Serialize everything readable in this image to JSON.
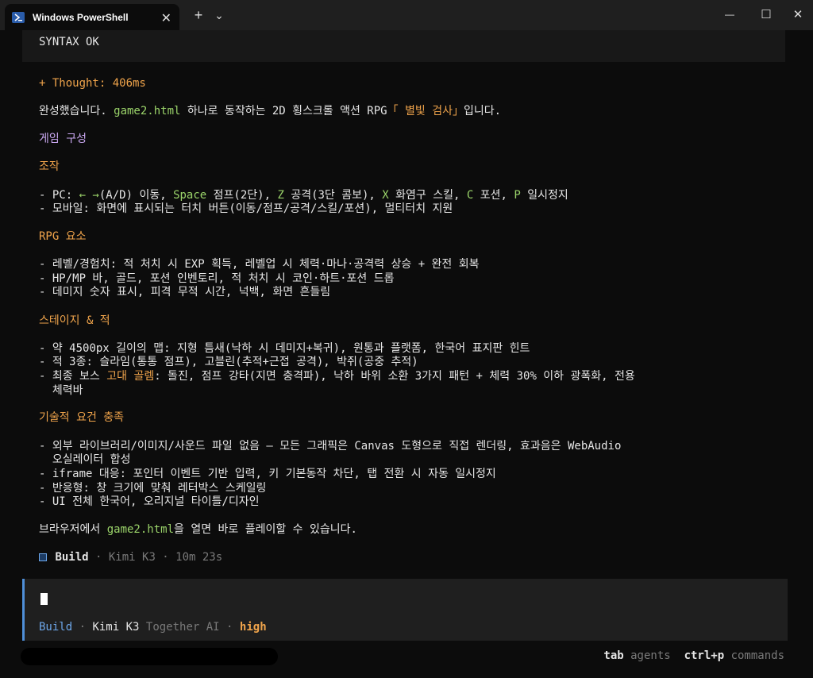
{
  "window": {
    "tab_title": "Windows PowerShell",
    "close_tab": "✕",
    "new_tab": "+",
    "dropdown": "⌄",
    "minimize": "—",
    "maximize": "☐",
    "close": "✕"
  },
  "output": {
    "syntax": "SYNTAX OK",
    "thought": "+ Thought: 406ms",
    "intro": {
      "a": "완성했습니다. ",
      "file": "game2.html",
      "b": " 하나로 동작하는 2D 횡스크롤 액션 RPG",
      "title": "「 별빛 검사」",
      "c": "입니다."
    },
    "h_game": "게임 구성",
    "h_controls": "조작",
    "pc": {
      "a": "- PC: ",
      "arrows": "← →",
      "b": "(A/D) 이동, ",
      "space": "Space",
      "c": " 점프(2단), ",
      "z": "Z",
      "d": " 공격(3단 콤보), ",
      "x": "X",
      "e": " 화염구 스킬, ",
      "cc": "C",
      "f": " 포션, ",
      "p": "P",
      "g": " 일시정지"
    },
    "mobile": "- 모바일: 화면에 표시되는 터치 버튼(이동/점프/공격/스킬/포션), 멀티터치 지원",
    "h_rpg": "RPG 요소",
    "rpg1": "- 레벨/경험치: 적 처치 시 EXP 획득, 레벨업 시 체력·마나·공격력 상승 + 완전 회복",
    "rpg2": "- HP/MP 바, 골드, 포션 인벤토리, 적 처치 시 코인·하트·포션 드롭",
    "rpg3": "- 데미지 숫자 표시, 피격 무적 시간, 넉백, 화면 흔들림",
    "h_stage": "스테이지 & 적",
    "st1": "- 약 4500px 길이의 맵: 지형 틈새(낙하 시 데미지+복귀), 원통과 플랫폼, 한국어 표지판 힌트",
    "st2": "- 적 3종: 슬라임(통통 점프), 고블린(추적+근접 공격), 박쥐(공중 추적)",
    "st3": {
      "a": "- 최종 보스 ",
      "boss": "고대 골렘",
      "b": ": 돌진, 점프 강타(지면 충격파), 낙하 바위 소환 3가지 패턴 + 체력 30% 이하 광폭화, 전용"
    },
    "st3b": "  체력바",
    "h_tech": "기술적 요건 충족",
    "t1": "- 외부 라이브러리/이미지/사운드 파일 없음 — 모든 그래픽은 Canvas 도형으로 직접 렌더링, 효과음은 WebAudio",
    "t1b": "  오실레이터 합성",
    "t2": "- iframe 대응: 포인터 이벤트 기반 입력, 키 기본동작 차단, 탭 전환 시 자동 일시정지",
    "t3": "- 반응형: 창 크기에 맞춰 레터박스 스케일링",
    "t4": "- UI 전체 한국어, 오리지널 타이틀/디자인",
    "outro": {
      "a": "브라우저에서 ",
      "file": "game2.html",
      "b": "을 열면 바로 플레이할 수 있습니다."
    },
    "build": {
      "label": "Build",
      "rest": " · Kimi K3 · 10m 23s"
    }
  },
  "input": {
    "mode": "Build",
    "sep1": " · ",
    "model": "Kimi K3",
    "provider": " Together AI",
    "sep2": " · ",
    "effort": "high"
  },
  "hints": {
    "k1": "tab",
    "v1": " agents  ",
    "k2": "ctrl+p",
    "v2": " commands"
  },
  "colors": {
    "accent_blue": "#6da7ea",
    "orange": "#f0a44b",
    "green": "#9bd46a",
    "purple": "#c9a7f0"
  }
}
